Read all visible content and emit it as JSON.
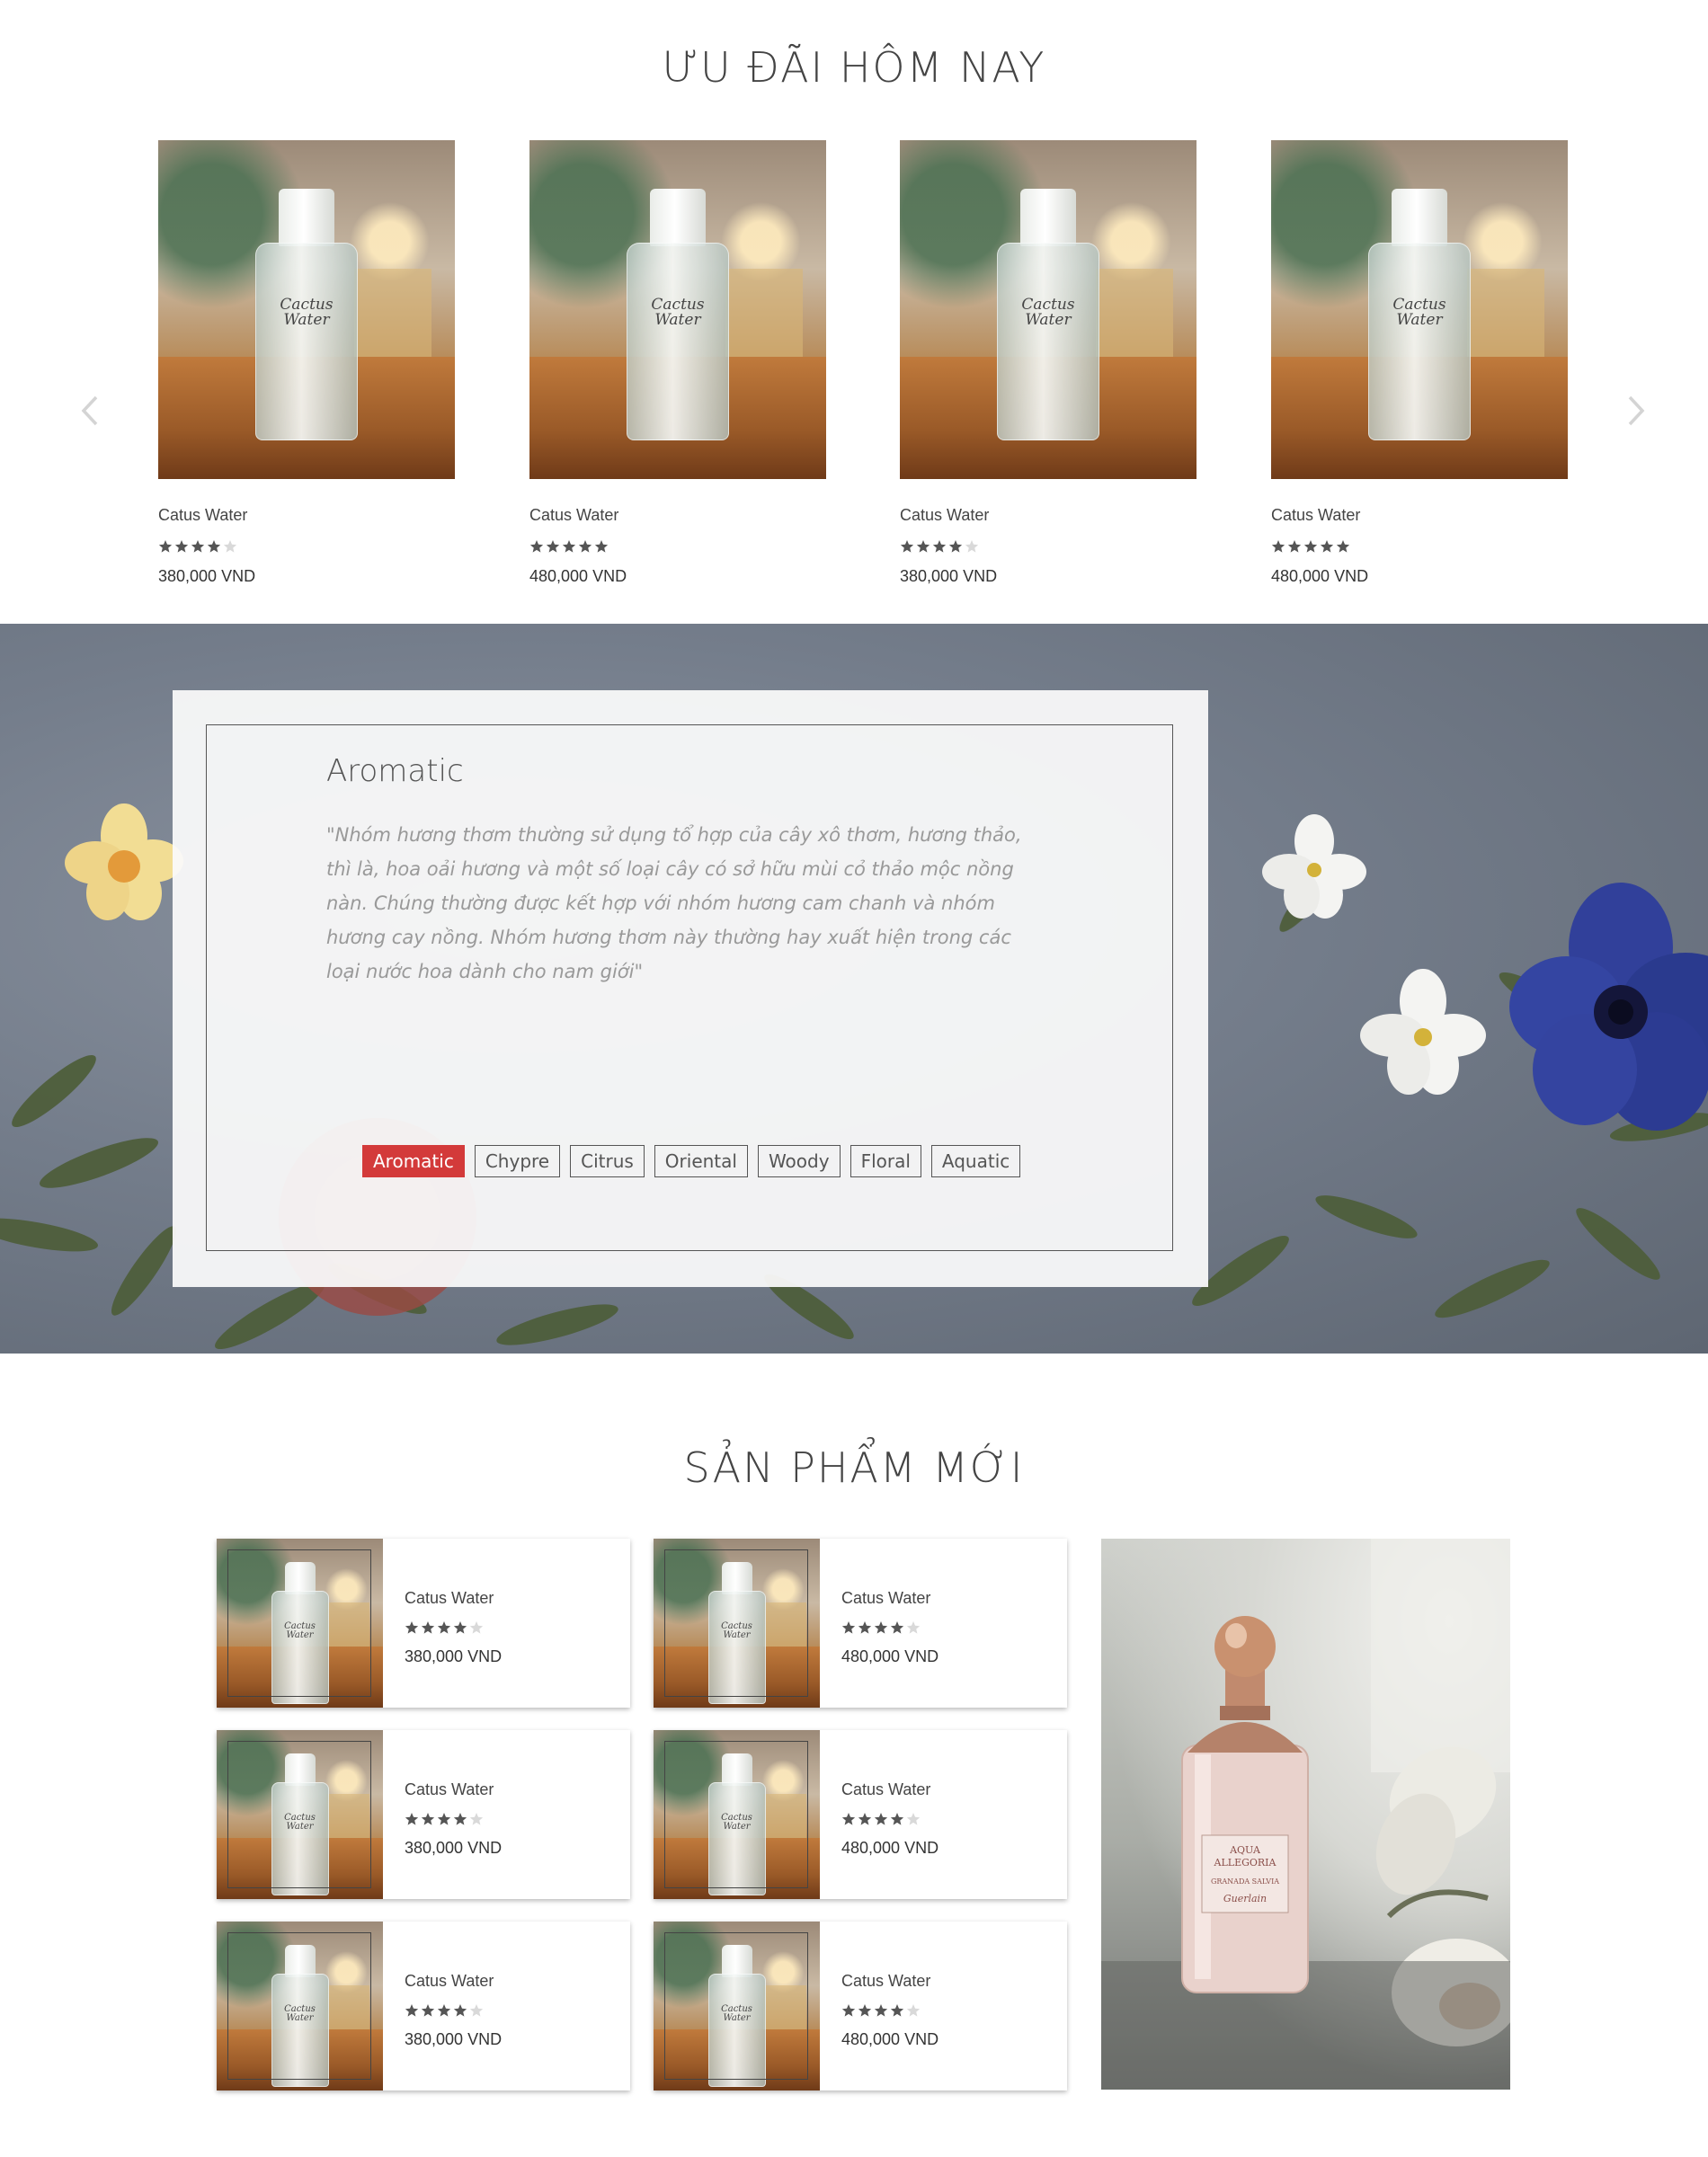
{
  "deals": {
    "title": "ƯU ĐÃI HÔM NAY",
    "prev_icon": "chevron-left-icon",
    "next_icon": "chevron-right-icon",
    "products": [
      {
        "name": "Catus Water",
        "label": "Cactus Water",
        "rating": 4,
        "price": "380,000 VND"
      },
      {
        "name": "Catus Water",
        "label": "Cactus Water",
        "rating": 5,
        "price": "480,000 VND"
      },
      {
        "name": "Catus Water",
        "label": "Cactus Water",
        "rating": 4,
        "price": "380,000 VND"
      },
      {
        "name": "Catus Water",
        "label": "Cactus Water",
        "rating": 5,
        "price": "480,000 VND"
      }
    ]
  },
  "aroma": {
    "title": "Aromatic",
    "description": "\"Nhóm hương thơm thường sử dụng tổ hợp của cây xô thơm, hương thảo, thì là, hoa oải hương và một số loại cây có sở hữu mùi cỏ thảo mộc nồng nàn. Chúng thường được kết hợp với nhóm hương cam chanh và nhóm hương cay nồng. Nhóm hương thơm này thường hay xuất hiện trong các loại nước hoa dành cho nam giới\"",
    "tabs": [
      "Aromatic",
      "Chypre",
      "Citrus",
      "Oriental",
      "Woody",
      "Floral",
      "Aquatic"
    ],
    "active_tab": "Aromatic"
  },
  "new_products": {
    "title": "SẢN PHẨM MỚI",
    "products": [
      {
        "name": "Catus Water",
        "label": "Cactus Water",
        "rating": 4,
        "price": "380,000 VND"
      },
      {
        "name": "Catus Water",
        "label": "Cactus Water",
        "rating": 4,
        "price": "480,000 VND"
      },
      {
        "name": "Catus Water",
        "label": "Cactus Water",
        "rating": 4,
        "price": "380,000 VND"
      },
      {
        "name": "Catus Water",
        "label": "Cactus Water",
        "rating": 4,
        "price": "480,000 VND"
      },
      {
        "name": "Catus Water",
        "label": "Cactus Water",
        "rating": 4,
        "price": "380,000 VND"
      },
      {
        "name": "Catus Water",
        "label": "Cactus Water",
        "rating": 4,
        "price": "480,000 VND"
      }
    ],
    "promo_image": {
      "label_line1": "AQUA",
      "label_line2": "ALLEGORIA",
      "label_line3": "GRANADA SALVIA",
      "brand": "Guerlain"
    }
  },
  "colors": {
    "accent": "#d33a3a",
    "star_filled": "#555555",
    "star_empty": "#d9d9d9"
  }
}
